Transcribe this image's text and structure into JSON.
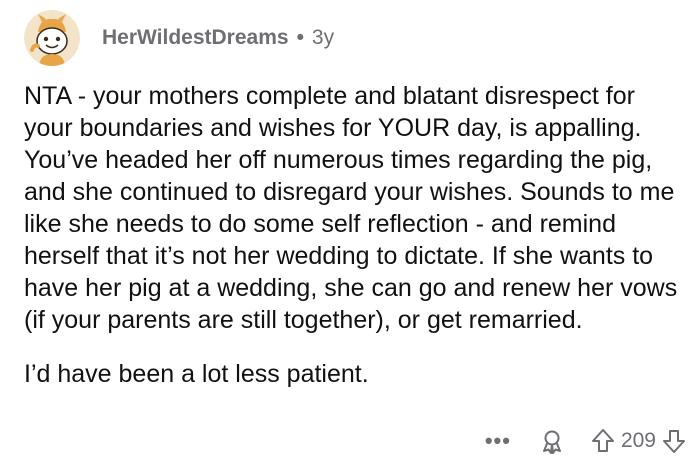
{
  "comment": {
    "username": "HerWildestDreams",
    "separator": "•",
    "age": "3y",
    "paragraphs": [
      "NTA - your mothers complete and blatant disrespect for your boundaries and wishes for YOUR day, is appalling. You’ve headed her off numerous times regarding the pig, and she continued to disregard your wishes. Sounds to me like she needs to do some self reflection - and remind herself that it’s not her wedding to dictate. If she wants to have her pig at a wedding, she can go and renew her vows (if your parents are still together), or get remarried.",
      "I’d have been a lot less patient."
    ]
  },
  "actions": {
    "more": "•••",
    "score": "209"
  },
  "icons": {
    "avatar": "snoo-avatar-icon",
    "award": "award-icon",
    "upvote": "upvote-arrow-icon",
    "downvote": "downvote-arrow-icon"
  },
  "colors": {
    "meta_text": "#6e6e73",
    "body_text": "#111111",
    "avatar_bg": "#f2e3c9"
  }
}
